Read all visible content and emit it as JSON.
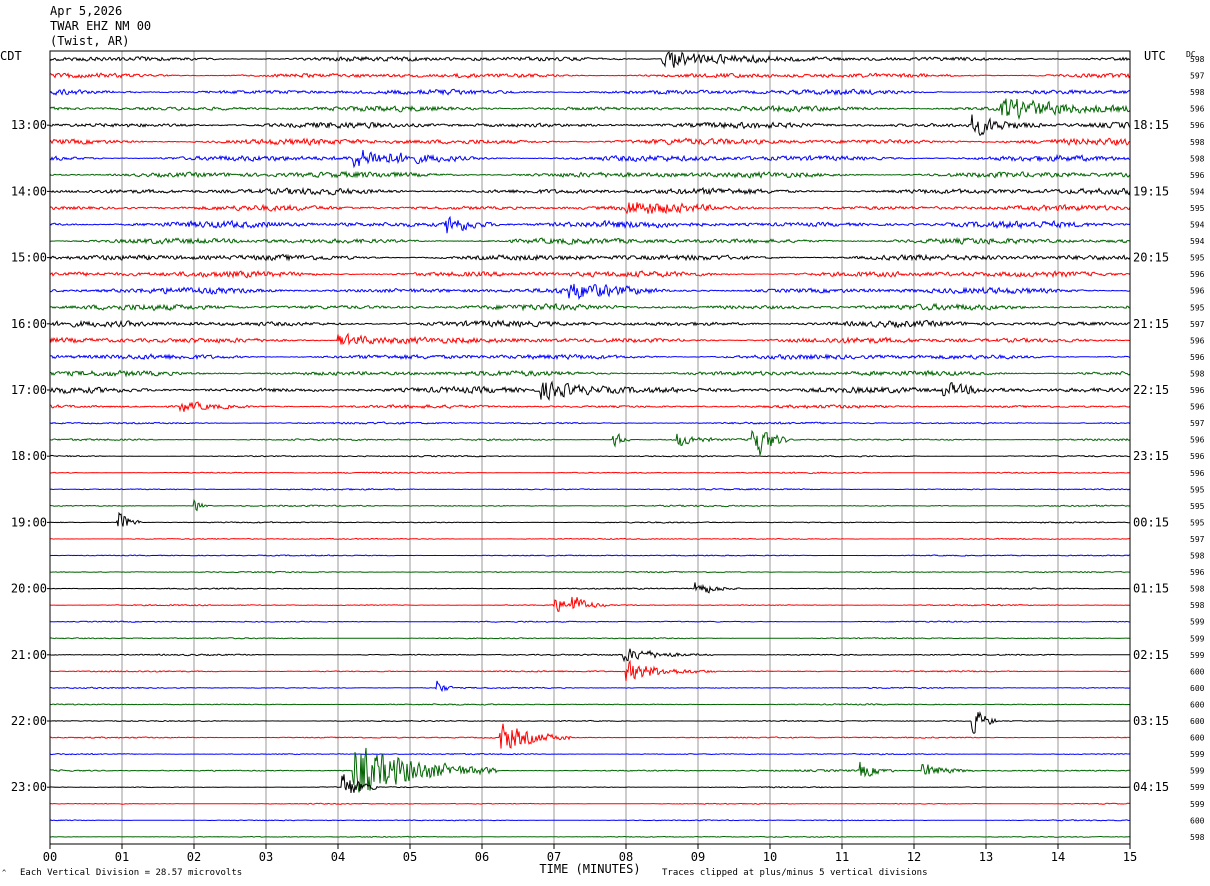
{
  "header": {
    "date": "Apr 5,2026",
    "channel": "TWAR EHZ NM 00",
    "location": "(Twist, AR)"
  },
  "footer": {
    "scale_note": "Each Vertical Division =   28.57 microvolts",
    "clip_note": "Traces clipped at plus/minus 5 vertical divisions",
    "corner_mark": "^"
  },
  "chart_data": {
    "type": "line",
    "title": "",
    "xlabel": "TIME (MINUTES)",
    "left_axis_label": "CDT",
    "right_axis_label": "UTC",
    "dc_label": "DC",
    "xlim": [
      0,
      15
    ],
    "x_ticks": [
      "00",
      "01",
      "02",
      "03",
      "04",
      "05",
      "06",
      "07",
      "08",
      "09",
      "10",
      "11",
      "12",
      "13",
      "14",
      "15"
    ],
    "grid": true,
    "trace_colors": [
      "#000000",
      "#ff0000",
      "#0000ff",
      "#006400"
    ],
    "cdt_hour_labels": [
      "13:00",
      "14:00",
      "15:00",
      "16:00",
      "17:00",
      "18:00",
      "19:00",
      "20:00",
      "21:00",
      "22:00",
      "23:00"
    ],
    "utc_hour_labels": [
      "18:15",
      "19:15",
      "20:15",
      "21:15",
      "22:15",
      "23:15",
      "00:15",
      "01:15",
      "02:15",
      "03:15",
      "04:15"
    ],
    "first_labeled_trace_index": 4,
    "dc_offsets": [
      598,
      597,
      598,
      596,
      596,
      598,
      598,
      596,
      594,
      595,
      594,
      594,
      595,
      596,
      596,
      595,
      597,
      596,
      596,
      598,
      596,
      596,
      597,
      596,
      596,
      596,
      595,
      595,
      595,
      597,
      598,
      596,
      598,
      598,
      599,
      599,
      599,
      600,
      600,
      600,
      600,
      600,
      599,
      599,
      599,
      599,
      600,
      598
    ],
    "trace_amplitude": [
      1.2,
      1.2,
      1.3,
      1.3,
      1.4,
      1.5,
      1.5,
      1.5,
      1.5,
      1.3,
      1.6,
      1.4,
      1.5,
      1.5,
      1.5,
      1.4,
      1.4,
      1.4,
      1.3,
      1.3,
      1.4,
      0.8,
      0.5,
      0.5,
      0.35,
      0.35,
      0.35,
      0.35,
      0.3,
      0.3,
      0.3,
      0.3,
      0.3,
      0.3,
      0.3,
      0.3,
      0.35,
      0.35,
      0.3,
      0.3,
      0.3,
      0.35,
      0.3,
      0.45,
      0.25,
      0.25,
      0.25,
      0.25
    ],
    "events": [
      {
        "trace": 0,
        "minute": 8.5,
        "amp": 6,
        "dur": 0.6
      },
      {
        "trace": 3,
        "minute": 13.2,
        "amp": 6,
        "dur": 0.9
      },
      {
        "trace": 4,
        "minute": 12.8,
        "amp": 6,
        "dur": 0.4
      },
      {
        "trace": 6,
        "minute": 4.2,
        "amp": 5,
        "dur": 0.6
      },
      {
        "trace": 9,
        "minute": 8.0,
        "amp": 4,
        "dur": 0.5
      },
      {
        "trace": 10,
        "minute": 5.5,
        "amp": 6,
        "dur": 0.3
      },
      {
        "trace": 14,
        "minute": 7.2,
        "amp": 4,
        "dur": 0.5
      },
      {
        "trace": 17,
        "minute": 4.0,
        "amp": 4,
        "dur": 0.5
      },
      {
        "trace": 20,
        "minute": 6.8,
        "amp": 5,
        "dur": 0.8
      },
      {
        "trace": 20,
        "minute": 12.4,
        "amp": 4,
        "dur": 0.5
      },
      {
        "trace": 21,
        "minute": 1.8,
        "amp": 3,
        "dur": 0.4
      },
      {
        "trace": 23,
        "minute": 7.8,
        "amp": 8,
        "dur": 0.1
      },
      {
        "trace": 23,
        "minute": 8.7,
        "amp": 5,
        "dur": 0.2
      },
      {
        "trace": 23,
        "minute": 9.75,
        "amp": 14,
        "dur": 0.2
      },
      {
        "trace": 27,
        "minute": 2.0,
        "amp": 4,
        "dur": 0.1
      },
      {
        "trace": 28,
        "minute": 0.93,
        "amp": 8,
        "dur": 0.15
      },
      {
        "trace": 32,
        "minute": 8.95,
        "amp": 5,
        "dur": 0.25
      },
      {
        "trace": 33,
        "minute": 7.0,
        "amp": 4,
        "dur": 0.3
      },
      {
        "trace": 33,
        "minute": 7.25,
        "amp": 5,
        "dur": 0.15
      },
      {
        "trace": 36,
        "minute": 7.95,
        "amp": 4,
        "dur": 0.5
      },
      {
        "trace": 37,
        "minute": 8.0,
        "amp": 6,
        "dur": 0.5
      },
      {
        "trace": 38,
        "minute": 5.35,
        "amp": 6,
        "dur": 0.1
      },
      {
        "trace": 40,
        "minute": 12.8,
        "amp": 10,
        "dur": 0.15
      },
      {
        "trace": 41,
        "minute": 6.25,
        "amp": 9,
        "dur": 0.4
      },
      {
        "trace": 43,
        "minute": 4.2,
        "amp": 16,
        "dur": 0.8
      },
      {
        "trace": 43,
        "minute": 11.25,
        "amp": 5,
        "dur": 0.2
      },
      {
        "trace": 43,
        "minute": 12.1,
        "amp": 5,
        "dur": 0.3
      },
      {
        "trace": 44,
        "minute": 4.05,
        "amp": 10,
        "dur": 0.2
      }
    ]
  }
}
